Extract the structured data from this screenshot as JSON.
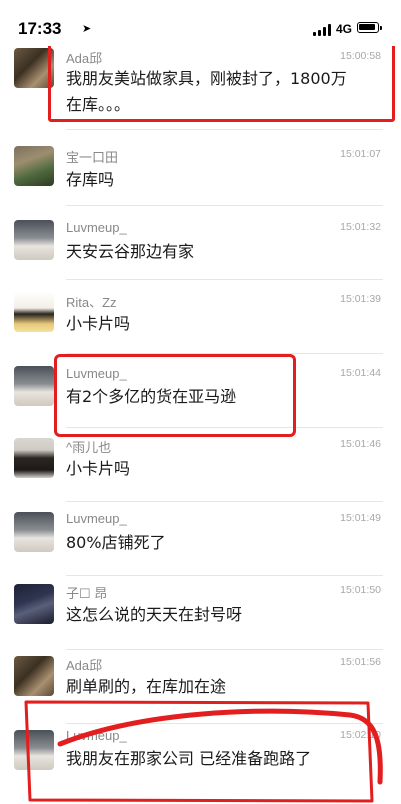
{
  "status_bar": {
    "time": "17:33",
    "network": "4G",
    "icons": [
      "location-arrow-icon",
      "signal-icon",
      "battery-icon"
    ]
  },
  "messages": [
    {
      "sender": "Ada邱",
      "time": "15:00:58",
      "text_lines": [
        "我朋友美站做家具，刚被封了，1800万",
        "在库。。。"
      ],
      "avatar": "ada"
    },
    {
      "sender": "宝一口田",
      "time": "15:01:07",
      "text_lines": [
        "存库吗"
      ],
      "avatar": "bao"
    },
    {
      "sender": "Luvmeup_",
      "time": "15:01:32",
      "text_lines": [
        "天安云谷那边有家"
      ],
      "avatar": "luv"
    },
    {
      "sender": "Rita、Zz",
      "time": "15:01:39",
      "text_lines": [
        "小卡片吗"
      ],
      "avatar": "rita"
    },
    {
      "sender": "Luvmeup_",
      "time": "15:01:44",
      "text_lines": [
        "有2个多亿的货在亚马逊"
      ],
      "avatar": "luv"
    },
    {
      "sender": "^雨儿也",
      "time": "15:01:46",
      "text_lines": [
        "小卡片吗"
      ],
      "avatar": "yu"
    },
    {
      "sender": "Luvmeup_",
      "time": "15:01:49",
      "text_lines": [
        "80%店铺死了"
      ],
      "avatar": "luv"
    },
    {
      "sender": "子☐ 昂",
      "time": "15:01:50",
      "text_lines": [
        "这怎么说的天天在封号呀"
      ],
      "avatar": "zi"
    },
    {
      "sender": "Ada邱",
      "time": "15:01:56",
      "text_lines": [
        "刷单刷的，在库加在途"
      ],
      "avatar": "ada"
    },
    {
      "sender": "Luvmeup_",
      "time": "15:02:10",
      "text_lines": [
        "我朋友在那家公司  已经准备跑路了"
      ],
      "avatar": "luv"
    }
  ],
  "annotation_color": "#e31e1e"
}
